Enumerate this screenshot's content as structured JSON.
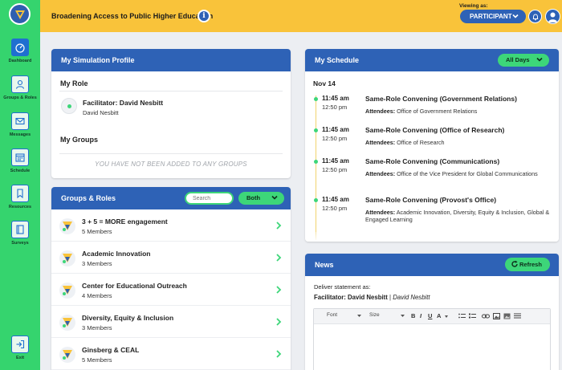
{
  "app": {
    "simulation_title": "Broadening Access to Public Higher Education",
    "viewing_as_label": "Viewing as:",
    "viewing_as_role": "PARTICIPANT",
    "colors": {
      "sidebar": "#35d46e",
      "topbar": "#f9c33a",
      "primary": "#2e62b6",
      "accent": "#3dd679"
    }
  },
  "sidebar": {
    "items": [
      {
        "label": "Dashboard",
        "icon": "gauge-icon",
        "active": true
      },
      {
        "label": "Groups & Roles",
        "icon": "person-icon",
        "active": false
      },
      {
        "label": "Messages",
        "icon": "envelope-icon",
        "active": false
      },
      {
        "label": "Schedule",
        "icon": "calendar-icon",
        "active": false
      },
      {
        "label": "Resources",
        "icon": "bookmark-icon",
        "active": false
      },
      {
        "label": "Surveys",
        "icon": "survey-icon",
        "active": false
      }
    ],
    "exit_label": "Exit"
  },
  "profile": {
    "title": "My Simulation Profile",
    "my_role_title": "My Role",
    "role_name": "Facilitator: David Nesbitt",
    "role_person": "David Nesbitt",
    "my_groups_title": "My Groups",
    "empty_groups": "YOU HAVE NOT BEEN ADDED TO ANY GROUPS"
  },
  "groups": {
    "title": "Groups & Roles",
    "search_placeholder": "Search",
    "filter_value": "Both",
    "items": [
      {
        "name": "3 + 5 = MORE engagement",
        "count": "5 Members"
      },
      {
        "name": "Academic Innovation",
        "count": "3 Members"
      },
      {
        "name": "Center for Educational Outreach",
        "count": "4 Members"
      },
      {
        "name": "Diversity, Equity & Inclusion",
        "count": "3 Members"
      },
      {
        "name": "Ginsberg & CEAL",
        "count": "5 Members"
      }
    ]
  },
  "schedule": {
    "title": "My Schedule",
    "filter_value": "All Days",
    "day": "Nov 14",
    "attendees_label": "Attendees:",
    "events": [
      {
        "start": "11:45 am",
        "end": "12:50 pm",
        "title": "Same-Role Convening (Government Relations)",
        "attendees": "Office of Government Relations"
      },
      {
        "start": "11:45 am",
        "end": "12:50 pm",
        "title": "Same-Role Convening (Office of Research)",
        "attendees": "Office of Research"
      },
      {
        "start": "11:45 am",
        "end": "12:50 pm",
        "title": "Same-Role Convening (Communications)",
        "attendees": "Office of the Vice President for Global Communications"
      },
      {
        "start": "11:45 am",
        "end": "12:50 pm",
        "title": "Same-Role Convening (Provost's Office)",
        "attendees": "Academic Innovation, Diversity, Equity & Inclusion, Global & Engaged Learning"
      }
    ]
  },
  "news": {
    "title": "News",
    "refresh_label": "Refresh",
    "deliver_label": "Deliver statement as:",
    "deliver_role": "Facilitator: David Nesbitt",
    "deliver_sep": "|",
    "deliver_person": "David Nesbitt",
    "editor": {
      "font_label": "Font",
      "size_label": "Size",
      "bold": "B",
      "italic": "I",
      "underline": "U",
      "color": "A"
    }
  }
}
